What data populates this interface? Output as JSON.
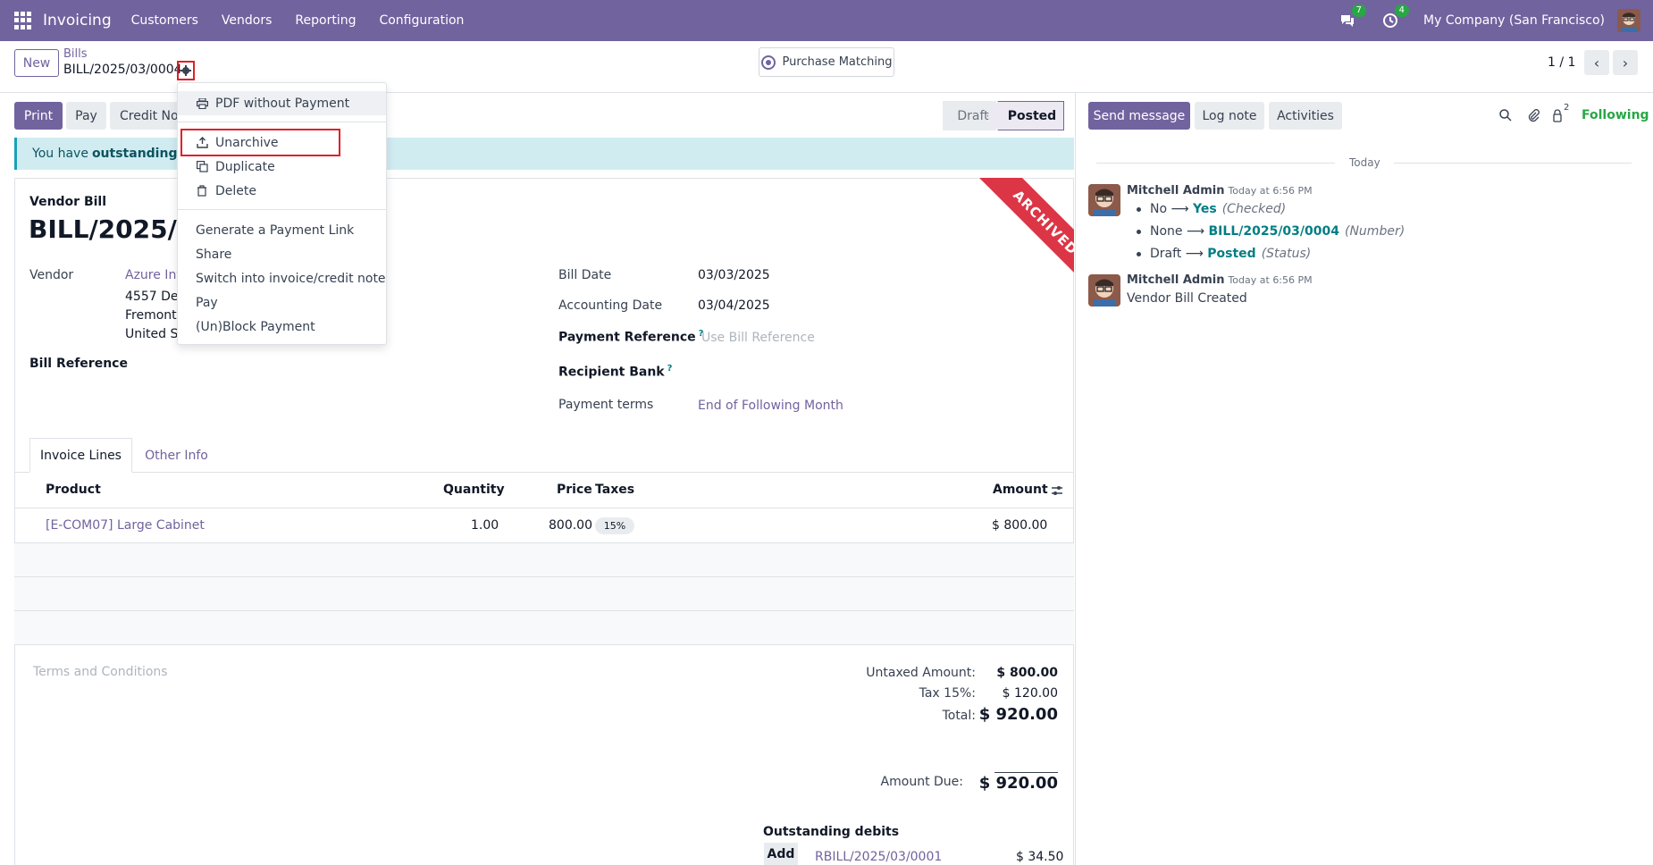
{
  "navbar": {
    "app_name": "Invoicing",
    "menu": [
      "Customers",
      "Vendors",
      "Reporting",
      "Configuration"
    ],
    "messages_badge": "7",
    "activities_badge": "4",
    "company": "My Company (San Francisco)",
    "color": "#71639e"
  },
  "control_panel": {
    "new_label": "New",
    "breadcrumb_parent": "Bills",
    "breadcrumb_current": "BILL/2025/03/0004",
    "purchase_matching_label": "Purchase Matching",
    "pager_value": "1 / 1"
  },
  "actions": {
    "print": "Print",
    "pay": "Pay",
    "credit_note": "Credit No"
  },
  "status": {
    "draft": "Draft",
    "posted": "Posted"
  },
  "alert": {
    "prefix": "You have ",
    "bold": "outstanding deb"
  },
  "ribbon": "ARCHIVED",
  "form": {
    "type_label": "Vendor Bill",
    "name": "BILL/2025/03",
    "vendor_label": "Vendor",
    "vendor_name": "Azure Int",
    "vendor_addr1": "4557 De S",
    "vendor_addr2": "Fremont",
    "vendor_addr3": "United St",
    "bill_reference_label": "Bill Reference",
    "bill_date_label": "Bill Date",
    "bill_date": "03/03/2025",
    "accounting_date_label": "Accounting Date",
    "accounting_date": "03/04/2025",
    "payment_reference_label": "Payment Reference",
    "payment_reference_placeholder": "Use Bill Reference",
    "recipient_bank_label": "Recipient Bank",
    "payment_terms_label": "Payment terms",
    "payment_terms": "End of Following Month",
    "help_mark": "?"
  },
  "tabs": {
    "invoice_lines": "Invoice Lines",
    "other_info": "Other Info"
  },
  "lines": {
    "headers": {
      "product": "Product",
      "quantity": "Quantity",
      "price": "Price",
      "taxes": "Taxes",
      "amount": "Amount"
    },
    "rows": [
      {
        "product": "[E-COM07] Large Cabinet",
        "quantity": "1.00",
        "price": "800.00",
        "tax": "15%",
        "amount": "$ 800.00"
      }
    ]
  },
  "terms_placeholder": "Terms and Conditions",
  "totals": {
    "untaxed_label": "Untaxed Amount:",
    "untaxed": "$ 800.00",
    "tax_label": "Tax 15%:",
    "tax": "$ 120.00",
    "total_label": "Total:",
    "total": "$ 920.00",
    "due_label": "Amount Due:",
    "due": "$ 920.00",
    "outstanding_label": "Outstanding debits",
    "add_label": "Add",
    "outstanding_ref": "RBILL/2025/03/0001",
    "outstanding_amount": "$ 34.50"
  },
  "chatter": {
    "send_message": "Send message",
    "log_note": "Log note",
    "activities": "Activities",
    "followers_count": "2",
    "following": "Following",
    "today": "Today",
    "messages": [
      {
        "author": "Mitchell Admin",
        "time": "Today at 6:56 PM",
        "changes": [
          {
            "old": "No",
            "new": "Yes",
            "field": "(Checked)"
          },
          {
            "old": "None",
            "new": "BILL/2025/03/0004",
            "field": "(Number)"
          },
          {
            "old": "Draft",
            "new": "Posted",
            "field": "(Status)"
          }
        ]
      },
      {
        "author": "Mitchell Admin",
        "time": "Today at 6:56 PM",
        "body": "Vendor Bill Created"
      }
    ],
    "arrow": "⟶"
  },
  "dropdown": {
    "items": [
      {
        "label": "PDF without Payment",
        "icon": "print-icon"
      },
      {
        "label": "Unarchive",
        "icon": "unarchive-icon"
      },
      {
        "label": "Duplicate",
        "icon": "copy-icon"
      },
      {
        "label": "Delete",
        "icon": "trash-icon"
      },
      {
        "label": "Generate a Payment Link"
      },
      {
        "label": "Share"
      },
      {
        "label": "Switch into invoice/credit note"
      },
      {
        "label": "Pay"
      },
      {
        "label": "(Un)Block Payment"
      }
    ]
  }
}
